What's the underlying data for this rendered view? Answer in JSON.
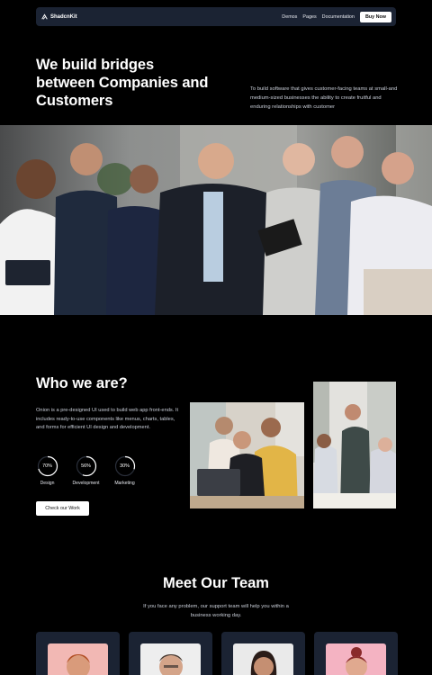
{
  "nav": {
    "brand": "ShadcnKit",
    "links": [
      "Demos",
      "Pages",
      "Documentation"
    ],
    "cta": "Buy Now"
  },
  "hero": {
    "title": "We build bridges between Companies and Customers",
    "description": "To build software that gives customer-facing teams at small-and medium-sized businesses the ability to create fruitful and enduring relationships with customer"
  },
  "who": {
    "title": "Who we are?",
    "description": "Onion is a pre-designed UI used to build web app front-ends. It includes ready-to-use components like menus, charts, tables, and forms for efficient UI design and development.",
    "stats": [
      {
        "value": "70%",
        "label": "Design",
        "percent": 70
      },
      {
        "value": "56%",
        "label": "Development",
        "percent": 56
      },
      {
        "value": "30%",
        "label": "Marketing",
        "percent": 30
      }
    ],
    "button": "Check our Work"
  },
  "team": {
    "title": "Meet Our Team",
    "description": "If you face any problem, our support team will help you within a business working day."
  },
  "colors": {
    "background": "#000000",
    "surface": "#1b2333",
    "accent": "#ffffff"
  }
}
